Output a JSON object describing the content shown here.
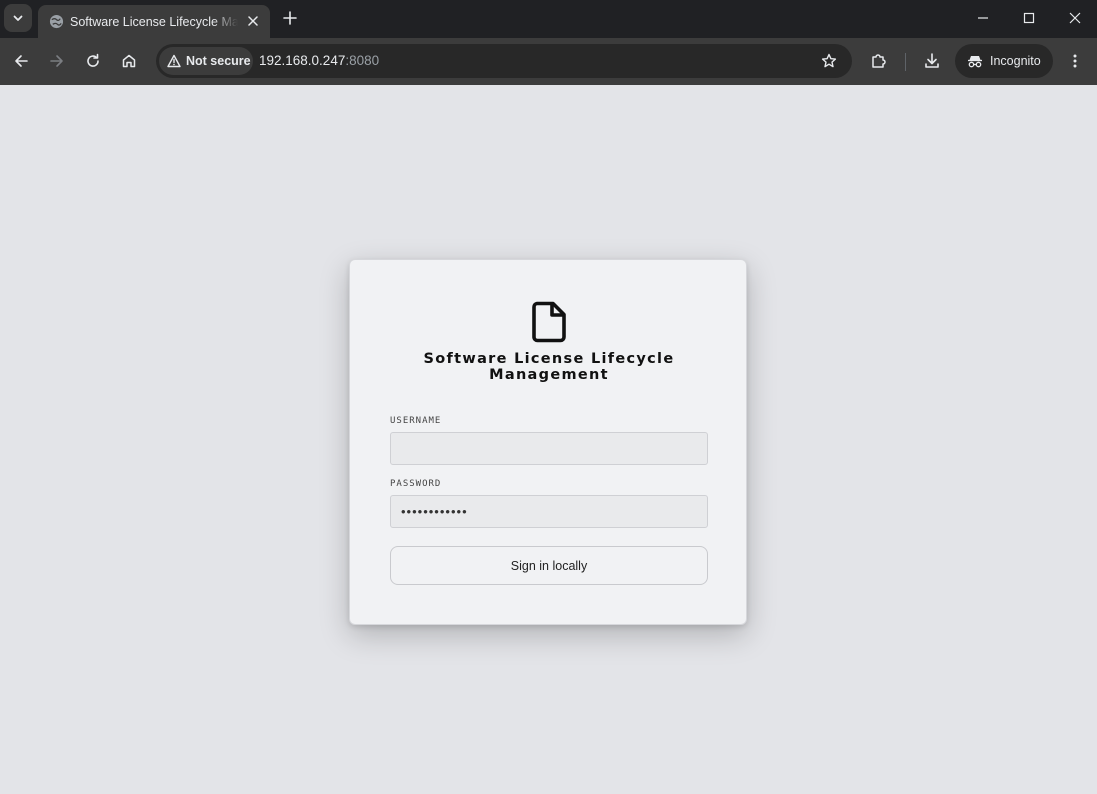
{
  "browser": {
    "tab": {
      "title": "Software License Lifecycle Management",
      "favicon": "globe-icon"
    },
    "address_bar": {
      "security_label": "Not secure",
      "url_host": "192.168.0.247",
      "url_port": ":8080"
    },
    "profile": {
      "label": "Incognito"
    }
  },
  "page": {
    "app_icon": "document-icon",
    "title_line1": "Software License Lifecycle",
    "title_line2": "Management",
    "username": {
      "label": "USERNAME",
      "value": ""
    },
    "password": {
      "label": "PASSWORD",
      "value": "••••••••••••"
    },
    "submit_label": "Sign in locally"
  },
  "colors": {
    "page_background": "#e3e4e8",
    "card_background": "#f1f2f4",
    "chrome_dark": "#202124",
    "chrome_toolbar": "#3c3c3c"
  }
}
